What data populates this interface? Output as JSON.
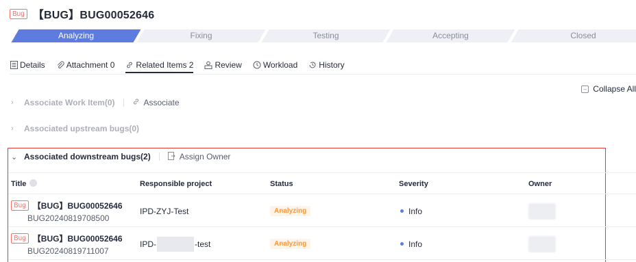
{
  "header": {
    "tag": "Bug",
    "title": "【BUG】BUG00052646"
  },
  "stepper": [
    "Analyzing",
    "Fixing",
    "Testing",
    "Accepting",
    "Closed"
  ],
  "tabs": [
    {
      "label": "Details",
      "icon": "document-icon"
    },
    {
      "label": "Attachment 0",
      "icon": "paperclip-icon"
    },
    {
      "label": "Related Items 2",
      "icon": "link-icon"
    },
    {
      "label": "Review",
      "icon": "review-icon"
    },
    {
      "label": "Workload",
      "icon": "clock-icon"
    },
    {
      "label": "History",
      "icon": "history-icon"
    }
  ],
  "collapse_all": "Collapse All",
  "sections": {
    "work_item": "Associate Work Item(0)",
    "associate": "Associate",
    "upstream": "Associated upstream bugs(0)",
    "downstream": "Associated downstream bugs(2)",
    "assign_owner": "Assign Owner"
  },
  "table": {
    "columns": [
      "Title",
      "Responsible project",
      "Status",
      "Severity",
      "Owner"
    ],
    "rows": [
      {
        "tag": "Bug",
        "title": "【BUG】BUG00052646",
        "id": "BUG20240819708500",
        "project": "IPD-ZYJ-Test",
        "status": "Analyzing",
        "severity": "Info"
      },
      {
        "tag": "Bug",
        "title": "【BUG】BUG00052646",
        "id": "BUG20240819711007",
        "project_prefix": "IPD-",
        "project_suffix": "-test",
        "status": "Analyzing",
        "severity": "Info"
      }
    ]
  },
  "colors": {
    "accent": "#5e7ce0",
    "bug_red": "#f66f6a",
    "status_orange": "#fa9841",
    "highlight_box": "#e53935"
  }
}
